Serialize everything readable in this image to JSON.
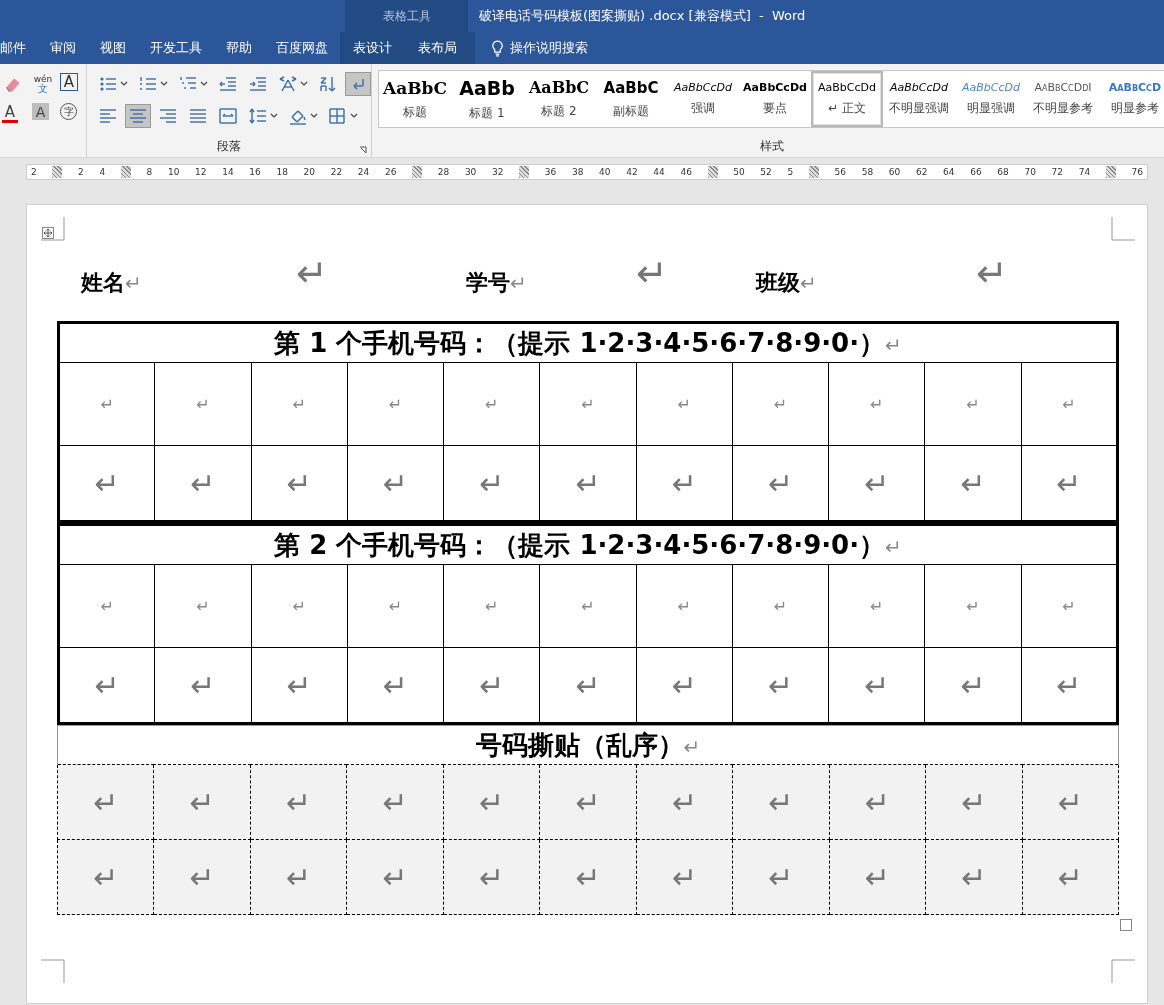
{
  "title_bar": {
    "context_label": "表格工具",
    "title": "破译电话号码模板(图案撕贴) .docx [兼容模式]  -  Word"
  },
  "ribbon_tabs": [
    {
      "label": "邮件",
      "kind": "normal"
    },
    {
      "label": "审阅",
      "kind": "normal"
    },
    {
      "label": "视图",
      "kind": "normal"
    },
    {
      "label": "开发工具",
      "kind": "normal"
    },
    {
      "label": "帮助",
      "kind": "normal"
    },
    {
      "label": "百度网盘",
      "kind": "normal"
    },
    {
      "label": "表设计",
      "kind": "contextual"
    },
    {
      "label": "表布局",
      "kind": "contextual"
    }
  ],
  "tell_me": {
    "label": "操作说明搜索"
  },
  "font_tools": [
    {
      "kind": "eraser"
    },
    {
      "kind": "phonetic",
      "top": "wén",
      "bottom": "文"
    },
    {
      "kind": "boxed",
      "text": "A"
    },
    {
      "kind": "font-color",
      "text": "A",
      "color": "#e00000"
    },
    {
      "kind": "shaded",
      "text": "A"
    },
    {
      "kind": "enclosed",
      "text": "字"
    }
  ],
  "paragraph_group": {
    "label": "段落",
    "rows": [
      [
        {
          "kind": "bullets",
          "dropdown": true,
          "pressed": false
        },
        {
          "kind": "numbering",
          "dropdown": true,
          "pressed": false
        },
        {
          "kind": "multilevel",
          "dropdown": true,
          "pressed": false
        },
        {
          "kind": "outdent",
          "dropdown": false,
          "pressed": false
        },
        {
          "kind": "indent",
          "dropdown": false,
          "pressed": false
        },
        {
          "kind": "asian-layout",
          "dropdown": true,
          "pressed": false
        },
        {
          "kind": "sort",
          "dropdown": false,
          "pressed": false
        },
        {
          "kind": "marks",
          "dropdown": false,
          "pressed": true
        }
      ],
      [
        {
          "kind": "align-left",
          "dropdown": false,
          "pressed": false
        },
        {
          "kind": "align-center",
          "dropdown": false,
          "pressed": true
        },
        {
          "kind": "align-right",
          "dropdown": false,
          "pressed": false
        },
        {
          "kind": "justify",
          "dropdown": false,
          "pressed": false
        },
        {
          "kind": "distribute",
          "dropdown": false,
          "pressed": false
        },
        {
          "kind": "line-spacing",
          "dropdown": true,
          "pressed": false
        },
        {
          "kind": "shading",
          "dropdown": true,
          "pressed": false
        },
        {
          "kind": "borders",
          "dropdown": true,
          "pressed": false
        }
      ]
    ]
  },
  "styles_group": {
    "label": "样式",
    "items": [
      {
        "sample": "AaBbC",
        "label": "标题",
        "kind": "title",
        "selected": false
      },
      {
        "sample": "AaBb",
        "label": "标题 1",
        "kind": "heading1",
        "selected": false
      },
      {
        "sample": "AaBbC",
        "label": "标题 2",
        "kind": "heading2",
        "selected": false
      },
      {
        "sample": "AaBbC",
        "label": "副标题",
        "kind": "subtitle",
        "selected": false
      },
      {
        "sample": "AaBbCcDd",
        "label": "强调",
        "kind": "emphasis",
        "selected": false
      },
      {
        "sample": "AaBbCcDd",
        "label": "要点",
        "kind": "strong",
        "selected": false
      },
      {
        "sample": "AaBbCcDd",
        "label": "↵ 正文",
        "kind": "normal",
        "selected": true
      },
      {
        "sample": "AaBbCcDd",
        "label": "不明显强调",
        "kind": "subtle-emphasis",
        "selected": false
      },
      {
        "sample": "AaBbCcDd",
        "label": "明显强调",
        "kind": "intense-emphasis",
        "selected": false
      },
      {
        "sample": "AaBbCcDdI",
        "label": "不明显参考",
        "kind": "subtle-reference",
        "selected": false
      },
      {
        "sample": "AaBbCcD",
        "label": "明显参考",
        "kind": "intense-reference",
        "selected": false
      }
    ]
  },
  "ruler": [
    {
      "kind": "num",
      "text": "2"
    },
    {
      "kind": "col"
    },
    {
      "kind": "num",
      "text": "2"
    },
    {
      "kind": "num",
      "text": "4"
    },
    {
      "kind": "col"
    },
    {
      "kind": "num",
      "text": "8"
    },
    {
      "kind": "num",
      "text": "10"
    },
    {
      "kind": "num",
      "text": "12"
    },
    {
      "kind": "num",
      "text": "14"
    },
    {
      "kind": "num",
      "text": "16"
    },
    {
      "kind": "num",
      "text": "18"
    },
    {
      "kind": "num",
      "text": "20"
    },
    {
      "kind": "num",
      "text": "22"
    },
    {
      "kind": "num",
      "text": "24"
    },
    {
      "kind": "num",
      "text": "26"
    },
    {
      "kind": "col"
    },
    {
      "kind": "num",
      "text": "28"
    },
    {
      "kind": "num",
      "text": "30"
    },
    {
      "kind": "num",
      "text": "32"
    },
    {
      "kind": "col"
    },
    {
      "kind": "num",
      "text": "36"
    },
    {
      "kind": "num",
      "text": "38"
    },
    {
      "kind": "num",
      "text": "40"
    },
    {
      "kind": "num",
      "text": "42"
    },
    {
      "kind": "num",
      "text": "44"
    },
    {
      "kind": "num",
      "text": "46"
    },
    {
      "kind": "col"
    },
    {
      "kind": "num",
      "text": "50"
    },
    {
      "kind": "num",
      "text": "52"
    },
    {
      "kind": "num",
      "text": "5"
    },
    {
      "kind": "col"
    },
    {
      "kind": "num",
      "text": "56"
    },
    {
      "kind": "num",
      "text": "58"
    },
    {
      "kind": "num",
      "text": "60"
    },
    {
      "kind": "num",
      "text": "62"
    },
    {
      "kind": "num",
      "text": "64"
    },
    {
      "kind": "num",
      "text": "66"
    },
    {
      "kind": "num",
      "text": "68"
    },
    {
      "kind": "num",
      "text": "70"
    },
    {
      "kind": "num",
      "text": "72"
    },
    {
      "kind": "num",
      "text": "74"
    },
    {
      "kind": "col"
    },
    {
      "kind": "num",
      "text": "76"
    }
  ],
  "name_line": [
    {
      "kind": "label",
      "text": "姓名",
      "mark": "↵"
    },
    {
      "kind": "end",
      "mark": "↵"
    },
    {
      "kind": "label",
      "text": "学号",
      "mark": "↵"
    },
    {
      "kind": "end",
      "mark": "↵"
    },
    {
      "kind": "label",
      "text": "班级",
      "mark": "↵"
    },
    {
      "kind": "end",
      "mark": "↵"
    }
  ],
  "tables": [
    {
      "kind": "solid",
      "header": "第 1 个手机号码：（提示 1·2·3·4·5·6·7·8·9·0·）",
      "mark": "↵",
      "rows": [
        {
          "kind": "small-mark",
          "cells": [
            "↵",
            "↵",
            "↵",
            "↵",
            "↵",
            "↵",
            "↵",
            "↵",
            "↵",
            "↵",
            "↵"
          ]
        },
        {
          "kind": "large-mark",
          "cells": [
            "↵",
            "↵",
            "↵",
            "↵",
            "↵",
            "↵",
            "↵",
            "↵",
            "↵",
            "↵",
            "↵"
          ]
        }
      ]
    },
    {
      "kind": "solid",
      "header": "第 2 个手机号码：（提示 1·2·3·4·5·6·7·8·9·0·）",
      "mark": "↵",
      "rows": [
        {
          "kind": "small-mark",
          "cells": [
            "↵",
            "↵",
            "↵",
            "↵",
            "↵",
            "↵",
            "↵",
            "↵",
            "↵",
            "↵",
            "↵"
          ]
        },
        {
          "kind": "large-mark",
          "cells": [
            "↵",
            "↵",
            "↵",
            "↵",
            "↵",
            "↵",
            "↵",
            "↵",
            "↵",
            "↵",
            "↵"
          ]
        }
      ]
    },
    {
      "kind": "dashed",
      "header": "号码撕贴（乱序）",
      "mark": "↵",
      "rows": [
        {
          "kind": "large-mark",
          "cells": [
            "↵",
            "↵",
            "↵",
            "↵",
            "↵",
            "↵",
            "↵",
            "↵",
            "↵",
            "↵",
            "↵"
          ]
        },
        {
          "kind": "large-mark",
          "cells": [
            "↵",
            "↵",
            "↵",
            "↵",
            "↵",
            "↵",
            "↵",
            "↵",
            "↵",
            "↵",
            "↵"
          ]
        }
      ]
    }
  ]
}
